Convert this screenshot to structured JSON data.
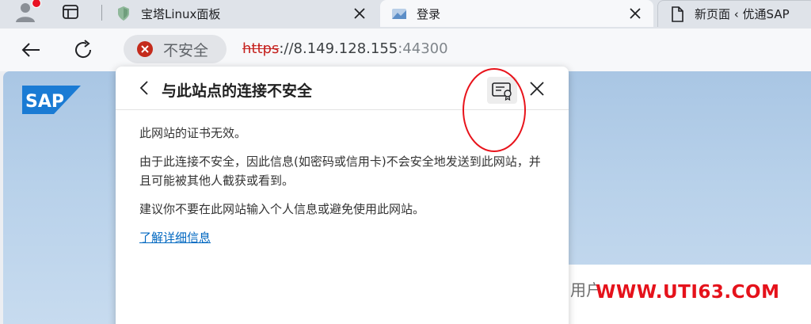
{
  "tabs": [
    {
      "title": "宝塔Linux面板",
      "icon": "shield-icon"
    },
    {
      "title": "登录",
      "icon": "sap-favicon-icon"
    },
    {
      "title": "新页面 ‹ 优通SAP",
      "icon": "page-icon"
    }
  ],
  "address_bar": {
    "security_label": "不安全",
    "url_scheme": "https",
    "url_sep": "://",
    "url_host": "8.149.128.155",
    "url_port": ":44300"
  },
  "popup": {
    "title": "与此站点的连接不安全",
    "paragraphs": [
      "此网站的证书无效。",
      "由于此连接不安全，因此信息(如密码或信用卡)不会安全地发送到此网站，并且可能被其他人截获或看到。",
      "建议你不要在此网站输入个人信息或避免使用此网站。"
    ],
    "learn_more": "了解详细信息"
  },
  "page": {
    "logo_text": "SAP",
    "user_label": "用户"
  },
  "watermark": "WWW.UTI63.COM",
  "colors": {
    "insecure_red": "#c5221f",
    "link_blue": "#0067c0",
    "annotation_red": "#e8131b"
  }
}
